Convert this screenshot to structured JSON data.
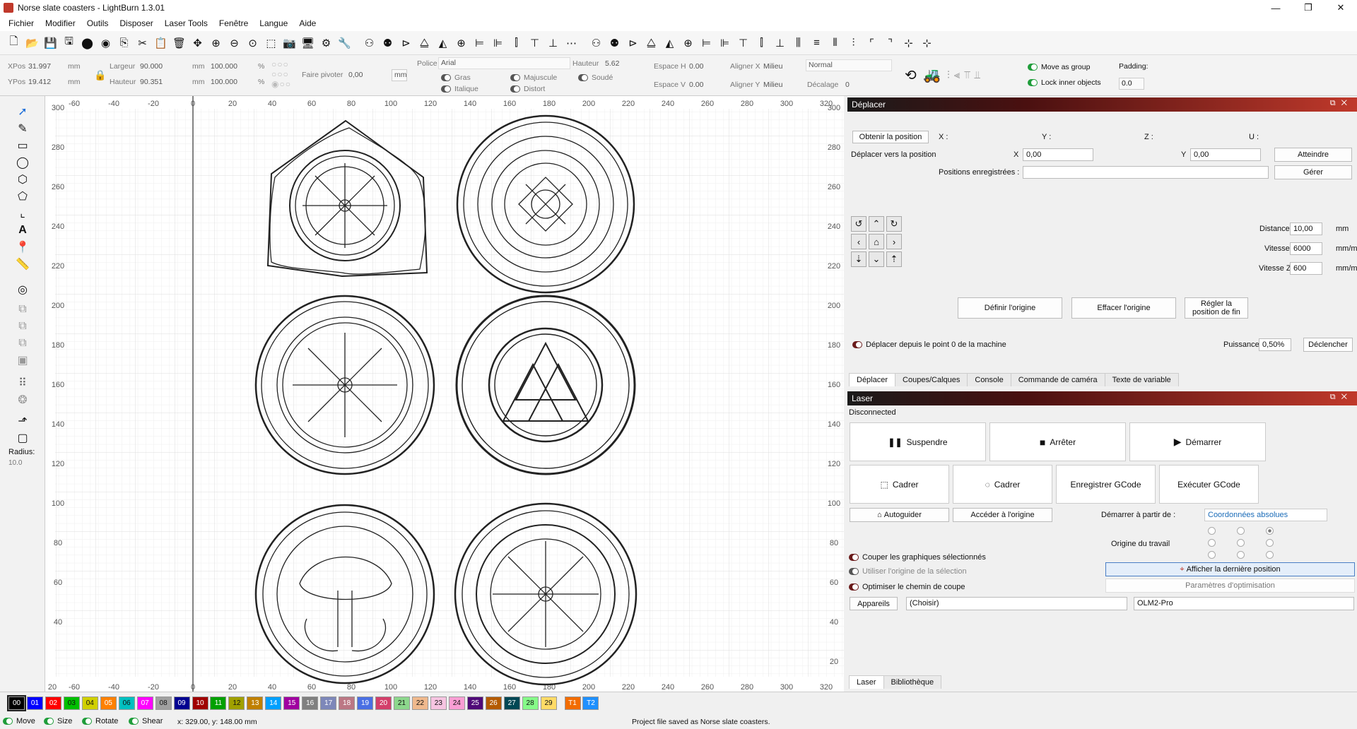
{
  "window": {
    "title": "Norse slate coasters - LightBurn 1.3.01",
    "min": "—",
    "max": "❐",
    "close": "✕"
  },
  "menu": [
    "Fichier",
    "Modifier",
    "Outils",
    "Disposer",
    "Laser Tools",
    "Fenêtre",
    "Langue",
    "Aide"
  ],
  "props": {
    "xpos_label": "XPos",
    "xpos": "31.997",
    "ypos_label": "YPos",
    "ypos": "19.412",
    "unit": "mm",
    "width_label": "Largeur",
    "width": "90.000",
    "height_label": "Hauteur",
    "height": "90.351",
    "scale_x": "100.000",
    "scale_y": "100.000",
    "percent": "%",
    "rotate_label": "Faire pivoter",
    "rotate": "0,00",
    "mm_btn": "mm",
    "font_label": "Police",
    "font": "Arial",
    "font_h_label": "Hauteur",
    "font_h": "5.62",
    "bold": "Gras",
    "italic": "Italique",
    "upper": "Majuscule",
    "distort": "Distort",
    "welded": "Soudé",
    "hspace_label": "Espace H",
    "hspace": "0.00",
    "vspace_label": "Espace V",
    "vspace": "0.00",
    "align_x_label": "Aligner X",
    "align_x": "Milieu",
    "align_y_label": "Aligner Y",
    "align_y": "Milieu",
    "mode": "Normal",
    "offset_label": "Décalage",
    "offset": "0",
    "move_group": "Move as group",
    "lock_inner": "Lock inner objects",
    "padding_label": "Padding:",
    "padding": "0.0"
  },
  "left_tools": {
    "radius_label": "Radius:",
    "radius": "10.0"
  },
  "ruler": {
    "top": [
      "-60",
      "-40",
      "-20",
      "0",
      "20",
      "40",
      "60",
      "80",
      "100",
      "120",
      "140",
      "160",
      "180",
      "200",
      "220",
      "240",
      "260",
      "280",
      "300",
      "320"
    ],
    "bottom": [
      "20",
      "-60",
      "-40",
      "-20",
      "0",
      "20",
      "40",
      "60",
      "80",
      "100",
      "120",
      "140",
      "160",
      "180",
      "200",
      "220",
      "240",
      "260",
      "280",
      "300",
      "320"
    ],
    "left": [
      "300",
      "280",
      "260",
      "240",
      "220",
      "200",
      "180",
      "160",
      "140",
      "120",
      "100",
      "80",
      "60",
      "40"
    ],
    "right": [
      "300",
      "280",
      "260",
      "240",
      "220",
      "200",
      "180",
      "160",
      "140",
      "120",
      "100",
      "80",
      "60",
      "40",
      "20"
    ]
  },
  "move_panel": {
    "title": "Déplacer",
    "get_pos": "Obtenir la position",
    "x_label": "X :",
    "y_label": "Y :",
    "z_label": "Z :",
    "u_label": "U :",
    "move_to": "Déplacer vers la position",
    "x": "X",
    "x_val": "0,00",
    "y": "Y",
    "y_val": "0,00",
    "goto": "Atteindre",
    "saved_pos": "Positions enregistrées :",
    "manage": "Gérer",
    "distance_label": "Distance",
    "distance": "10,00",
    "dist_unit": "mm",
    "speed_label": "Vitesse",
    "speed": "6000",
    "speed_unit": "mm/m",
    "speedz_label": "Vitesse Z",
    "speedz": "600",
    "speedz_unit": "mm/m",
    "set_origin": "Définir l'origine",
    "clear_origin": "Effacer l'origine",
    "set_finish": "Régler la position de fin",
    "move_from_zero": "Déplacer depuis le point 0 de la machine",
    "power_label": "Puissance",
    "power": "0,50%",
    "fire": "Déclencher"
  },
  "mid_tabs": [
    "Déplacer",
    "Coupes/Calques",
    "Console",
    "Commande de caméra",
    "Texte de variable"
  ],
  "laser_panel": {
    "title": "Laser",
    "status": "Disconnected",
    "pause": "Suspendre",
    "stop": "Arrêter",
    "start": "Démarrer",
    "frame1": "Cadrer",
    "frame2": "Cadrer",
    "save_gcode": "Enregistrer GCode",
    "run_gcode": "Exécuter GCode",
    "home": "Autoguider",
    "goto_origin": "Accéder à l'origine",
    "start_from_label": "Démarrer à partir de :",
    "start_from": "Coordonnées absolues",
    "job_origin": "Origine du travail",
    "cut_selected": "Couper les graphiques sélectionnés",
    "use_sel_origin": "Utiliser l'origine de la sélection",
    "optimize": "Optimiser le chemin de coupe",
    "show_last": "Afficher la dernière position",
    "opt_settings": "Paramètres d'optimisation",
    "devices": "Appareils",
    "choose": "(Choisir)",
    "device": "OLM2-Pro"
  },
  "bottom_tabs": [
    "Laser",
    "Bibliothèque"
  ],
  "palette": [
    {
      "id": "00",
      "c": "#000000"
    },
    {
      "id": "01",
      "c": "#0000ff"
    },
    {
      "id": "02",
      "c": "#ff0000"
    },
    {
      "id": "03",
      "c": "#00c000"
    },
    {
      "id": "04",
      "c": "#d0d000"
    },
    {
      "id": "05",
      "c": "#ff8000"
    },
    {
      "id": "06",
      "c": "#00c0c0"
    },
    {
      "id": "07",
      "c": "#ff00ff"
    },
    {
      "id": "08",
      "c": "#a0a0a0"
    },
    {
      "id": "09",
      "c": "#000090"
    },
    {
      "id": "10",
      "c": "#a00000"
    },
    {
      "id": "11",
      "c": "#00a000"
    },
    {
      "id": "12",
      "c": "#a0a000"
    },
    {
      "id": "13",
      "c": "#c08000"
    },
    {
      "id": "14",
      "c": "#00a0ff"
    },
    {
      "id": "15",
      "c": "#a000a0"
    },
    {
      "id": "16",
      "c": "#808080"
    },
    {
      "id": "17",
      "c": "#7d87b9"
    },
    {
      "id": "18",
      "c": "#bb7784"
    },
    {
      "id": "19",
      "c": "#4a6fe3"
    },
    {
      "id": "20",
      "c": "#d33f6a"
    },
    {
      "id": "21",
      "c": "#8cd78c"
    },
    {
      "id": "22",
      "c": "#f0b98d"
    },
    {
      "id": "23",
      "c": "#f6c4e1"
    },
    {
      "id": "24",
      "c": "#fa9ed4"
    },
    {
      "id": "25",
      "c": "#500a78"
    },
    {
      "id": "26",
      "c": "#b45a00"
    },
    {
      "id": "27",
      "c": "#004754"
    },
    {
      "id": "28",
      "c": "#86fa88"
    },
    {
      "id": "29",
      "c": "#ffdb66"
    },
    {
      "id": "T1",
      "c": "#f26c00"
    },
    {
      "id": "T2",
      "c": "#1e90ff"
    }
  ],
  "status": {
    "move": "Move",
    "size": "Size",
    "rotate": "Rotate",
    "shear": "Shear",
    "coords": "x: 329.00, y: 148.00 mm",
    "message": "Project file saved as Norse slate coasters."
  }
}
